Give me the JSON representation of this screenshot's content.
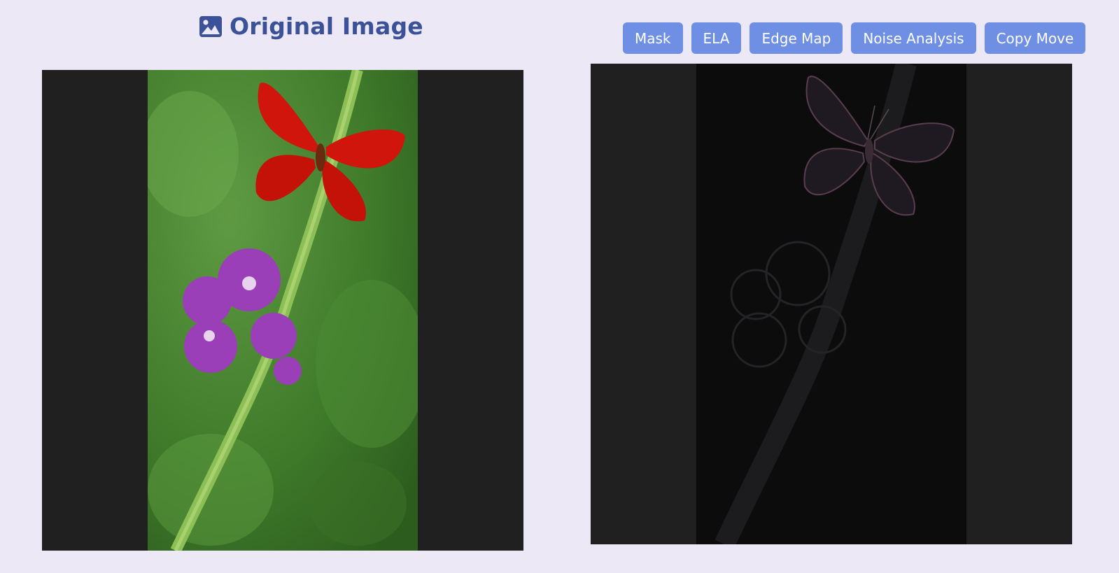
{
  "header": {
    "title": "Original Image",
    "icon": "image-icon"
  },
  "toolbar": {
    "buttons": [
      {
        "label": "Mask"
      },
      {
        "label": "ELA"
      },
      {
        "label": "Edge Map"
      },
      {
        "label": "Noise Analysis"
      },
      {
        "label": "Copy Move"
      }
    ]
  },
  "colors": {
    "accent": "#3c5298",
    "button": "#6f8fe4",
    "background": "#ece8f6",
    "panel": "#202020"
  }
}
